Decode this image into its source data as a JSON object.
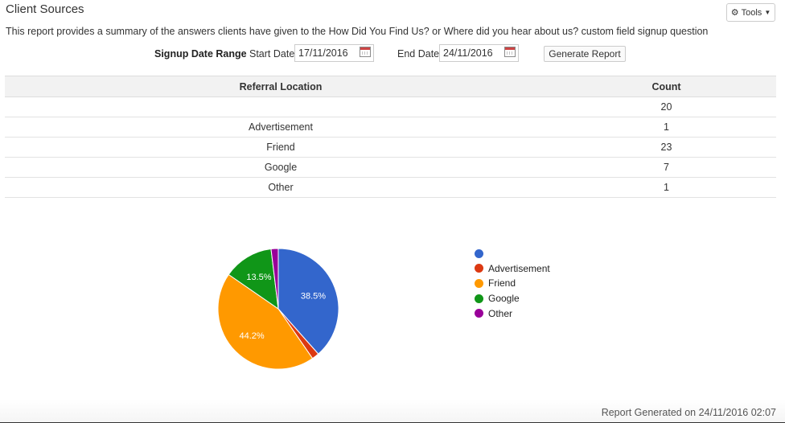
{
  "header": {
    "title": "Client Sources",
    "tools_label": "Tools",
    "description": "This report provides a summary of the answers clients have given to the How Did You Find Us? or Where did you hear about us? custom field signup question"
  },
  "filters": {
    "range_label": "Signup Date Range",
    "start_label": "Start Date:",
    "start_value": "17/11/2016",
    "end_label": "End Date:",
    "end_value": "24/11/2016",
    "generate_label": "Generate Report"
  },
  "table": {
    "headers": [
      "Referral Location",
      "Count"
    ],
    "rows": [
      {
        "location": "",
        "count": "20"
      },
      {
        "location": "Advertisement",
        "count": "1"
      },
      {
        "location": "Friend",
        "count": "23"
      },
      {
        "location": "Google",
        "count": "7"
      },
      {
        "location": "Other",
        "count": "1"
      }
    ]
  },
  "chart_data": {
    "type": "pie",
    "categories": [
      "",
      "Advertisement",
      "Friend",
      "Google",
      "Other"
    ],
    "values": [
      20,
      1,
      23,
      7,
      1
    ],
    "slice_labels": [
      "38.5%",
      "",
      "44.2%",
      "13.5%",
      ""
    ],
    "colors": [
      "#3366cc",
      "#dc3912",
      "#ff9900",
      "#109618",
      "#990099"
    ],
    "legend_position": "right"
  },
  "footer": {
    "generated": "Report Generated on 24/11/2016 02:07"
  }
}
